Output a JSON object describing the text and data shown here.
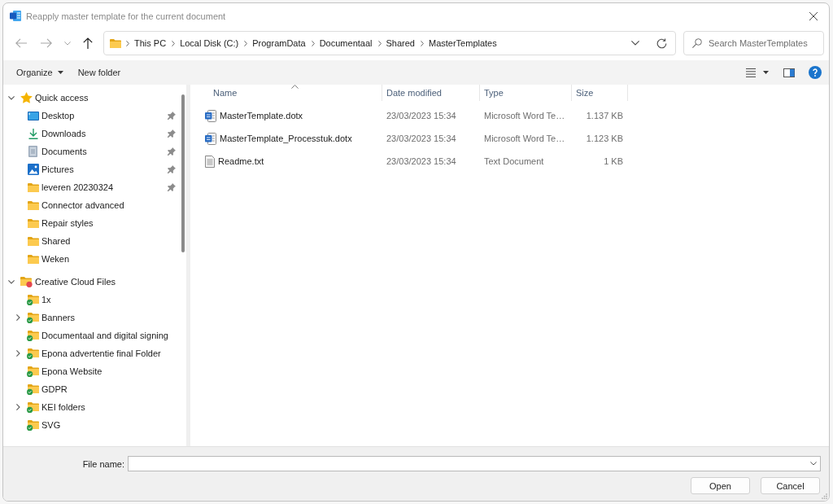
{
  "window": {
    "title": "Reapply master template for the current document"
  },
  "navigation": [
    {
      "kind": "back",
      "disabled": true
    },
    {
      "kind": "forward",
      "disabled": true
    },
    {
      "kind": "recent",
      "disabled": true
    },
    {
      "kind": "up",
      "disabled": false
    }
  ],
  "address_bar": {
    "breadcrumbs": [
      "This PC",
      "Local Disk (C:)",
      "ProgramData",
      "Documentaal",
      "Shared",
      "MasterTemplates"
    ]
  },
  "search": {
    "placeholder": "Search MasterTemplates"
  },
  "toolbar": {
    "organize": "Organize",
    "new_folder": "New folder"
  },
  "sidebar": {
    "items": [
      {
        "label": "Quick access",
        "kind": "star",
        "expandable": true,
        "expanded": true,
        "selected": false,
        "children": [
          {
            "label": "Desktop",
            "kind": "desktop",
            "expandable": false,
            "pinned": true,
            "selected": false
          },
          {
            "label": "Downloads",
            "kind": "downloads",
            "expandable": false,
            "pinned": true,
            "selected": false
          },
          {
            "label": "Documents",
            "kind": "documents",
            "expandable": false,
            "pinned": true,
            "selected": false
          },
          {
            "label": "Pictures",
            "kind": "pictures",
            "expandable": false,
            "pinned": true,
            "selected": false
          },
          {
            "label": "leveren 20230324",
            "kind": "folder",
            "expandable": false,
            "pinned": true,
            "selected": false
          },
          {
            "label": "Connector advanced",
            "kind": "folder",
            "expandable": false,
            "pinned": false,
            "selected": false
          },
          {
            "label": "Repair styles",
            "kind": "folder",
            "expandable": false,
            "pinned": false,
            "selected": false
          },
          {
            "label": "Shared",
            "kind": "folder",
            "expandable": false,
            "pinned": false,
            "selected": false
          },
          {
            "label": "Weken",
            "kind": "folder",
            "expandable": false,
            "pinned": false,
            "selected": false
          }
        ]
      },
      {
        "label": "Creative Cloud Files",
        "kind": "cloud-folder",
        "expandable": true,
        "expanded": true,
        "selected": false,
        "children": [
          {
            "label": "1x",
            "kind": "synced-folder",
            "expandable": false,
            "selected": false
          },
          {
            "label": "Banners",
            "kind": "synced-folder",
            "expandable": true,
            "expanded": false,
            "selected": false
          },
          {
            "label": "Documentaal and digital signing",
            "kind": "synced-folder",
            "expandable": false,
            "selected": false
          },
          {
            "label": "Epona advertentie final Folder",
            "kind": "synced-folder",
            "expandable": true,
            "expanded": false,
            "selected": false
          },
          {
            "label": "Epona Website",
            "kind": "synced-folder",
            "expandable": false,
            "selected": false
          },
          {
            "label": "GDPR",
            "kind": "synced-folder",
            "expandable": false,
            "selected": false
          },
          {
            "label": "KEI folders",
            "kind": "synced-folder",
            "expandable": true,
            "expanded": false,
            "selected": false
          },
          {
            "label": "SVG",
            "kind": "synced-folder",
            "expandable": false,
            "selected": false
          }
        ]
      }
    ]
  },
  "file_list": {
    "columns": [
      {
        "label": "Name",
        "sorted": true
      },
      {
        "label": "Date modified",
        "sorted": false
      },
      {
        "label": "Type",
        "sorted": false
      },
      {
        "label": "Size",
        "sorted": false
      }
    ],
    "rows": [
      {
        "name": "MasterTemplate.dotx",
        "kind": "word",
        "date_modified": "23/03/2023 15:34",
        "type": "Microsoft Word Te…",
        "size": "1.137 KB",
        "selected": false
      },
      {
        "name": "MasterTemplate_Processtuk.dotx",
        "kind": "word",
        "date_modified": "23/03/2023 15:34",
        "type": "Microsoft Word Te…",
        "size": "1.123 KB",
        "selected": false
      },
      {
        "name": "Readme.txt",
        "kind": "text",
        "date_modified": "23/03/2023 15:34",
        "type": "Text Document",
        "size": "1 KB",
        "selected": false
      }
    ]
  },
  "file_name": {
    "label": "File name:"
  },
  "buttons": [
    {
      "label": "Open"
    },
    {
      "label": "Cancel"
    }
  ]
}
